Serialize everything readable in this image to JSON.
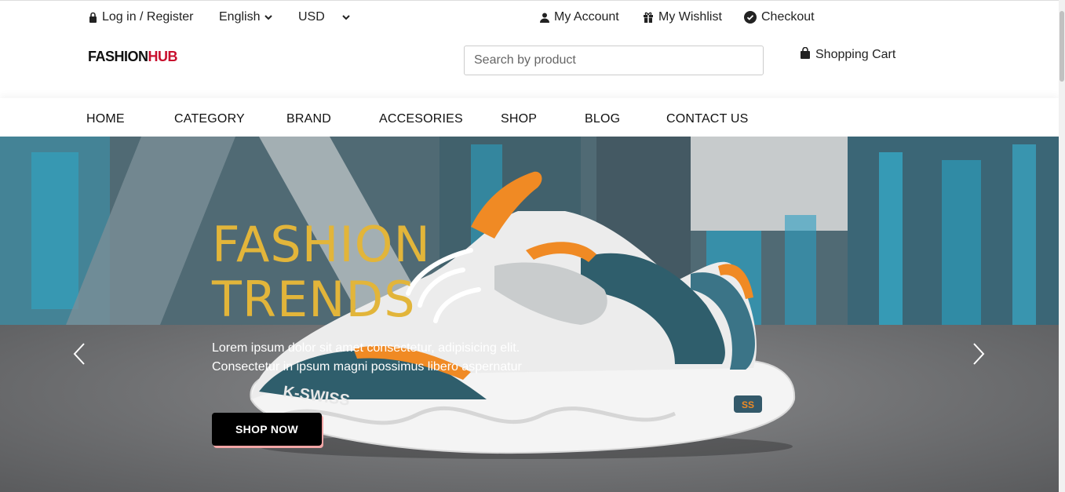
{
  "topbar": {
    "login_label": "Log in / Register",
    "language": "English",
    "currency": "USD",
    "account_label": "My Account",
    "wishlist_label": "My Wishlist",
    "checkout_label": "Checkout"
  },
  "header": {
    "logo_part1": "FASHION",
    "logo_part2": "HUB",
    "search_placeholder": "Search by product",
    "cart_label": "Shopping Cart"
  },
  "nav": {
    "items": [
      "HOME",
      "CATEGORY",
      "BRAND",
      "ACCESORIES",
      "SHOP",
      "BLOG",
      "CONTACT US"
    ]
  },
  "hero": {
    "title_line1": "FASHION",
    "title_line2": "TRENDS",
    "text_line1": "Lorem ipsum dolor sit amet consectetur, adipisicing elit.",
    "text_line2": "Consectetur in ipsum magni possimus libero aspernatur",
    "button_label": "SHOP NOW",
    "shoe_brand": "K-SWISS"
  },
  "colors": {
    "accent_title": "#e2b53a",
    "logo_red": "#c8102e",
    "button_bg": "#000000",
    "button_shadow": "#f2a5a5"
  }
}
